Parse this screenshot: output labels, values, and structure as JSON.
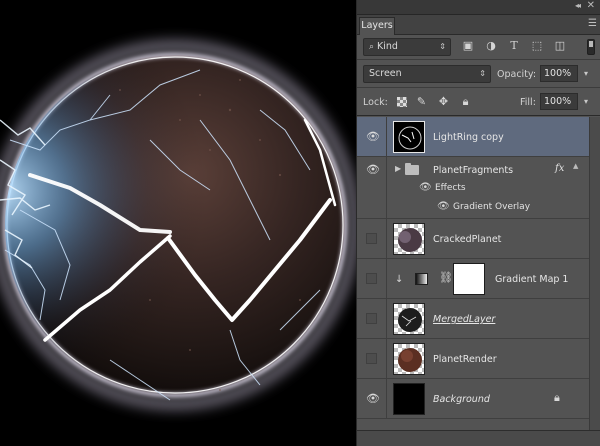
{
  "panel": {
    "tab_label": "Layers",
    "filter": {
      "kind_label": "Kind",
      "icons": [
        "image-filter-icon",
        "adjustment-filter-icon",
        "type-filter-icon",
        "shape-filter-icon",
        "smart-object-filter-icon"
      ]
    },
    "blend_mode": "Screen",
    "opacity_label": "Opacity:",
    "opacity_value": "100%",
    "lock_label": "Lock:",
    "fill_label": "Fill:",
    "fill_value": "100%"
  },
  "layers": [
    {
      "name": "LightRing copy",
      "visible": true,
      "selected": true,
      "thumb": "lightring"
    },
    {
      "name": "PlanetFragments",
      "visible": true,
      "type": "group",
      "has_fx": true,
      "effects_label": "Effects",
      "effect_item": "Gradient Overlay"
    },
    {
      "name": "CrackedPlanet",
      "visible": false,
      "thumb": "cracked"
    },
    {
      "name": "Gradient Map 1",
      "visible": false,
      "type": "adjustment"
    },
    {
      "name": "MergedLayer",
      "visible": false,
      "thumb": "merged",
      "underlined": true
    },
    {
      "name": "PlanetRender",
      "visible": false,
      "thumb": "render"
    },
    {
      "name": "Background",
      "visible": true,
      "thumb": "black",
      "locked": true,
      "italic": true
    }
  ]
}
